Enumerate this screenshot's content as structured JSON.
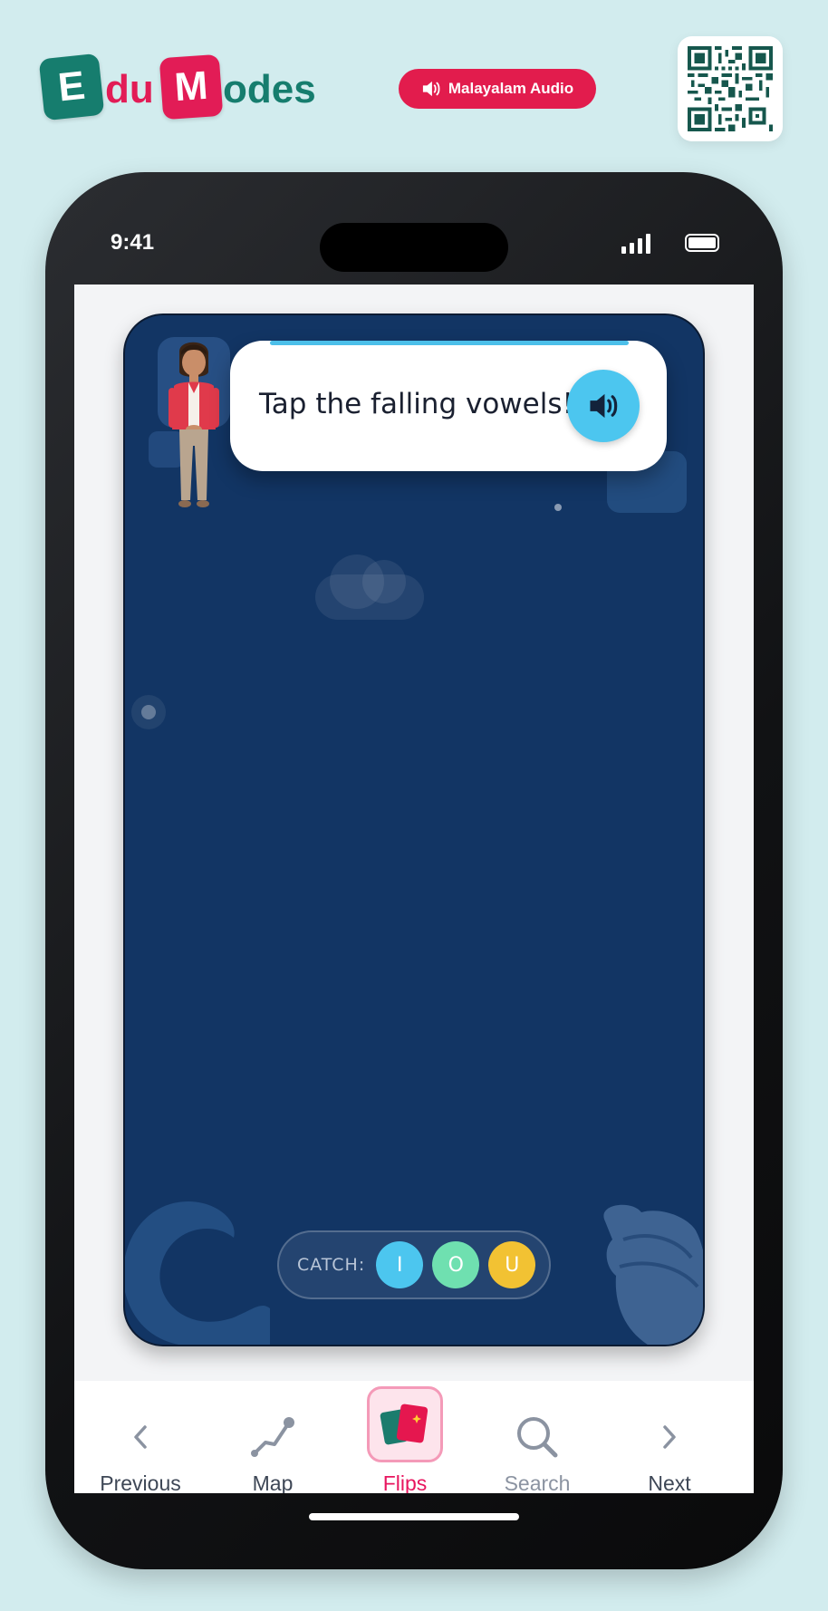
{
  "brand": {
    "tile_e": "E",
    "text_du": "du",
    "tile_m": "M",
    "text_odes": "odes"
  },
  "header": {
    "audio_label": "Malayalam Audio",
    "colors": {
      "teal": "#167d6e",
      "pink": "#e21c56",
      "background": "#d2ecee"
    }
  },
  "status_bar": {
    "time": "9:41"
  },
  "game": {
    "prompt": "Tap the falling vowels!",
    "catch_label": "CATCH:",
    "vowels": [
      {
        "letter": "I",
        "color": "#4cc6ef"
      },
      {
        "letter": "O",
        "color": "#6fe0b0"
      },
      {
        "letter": "U",
        "color": "#f2c233"
      }
    ],
    "background": "#123564"
  },
  "nav": {
    "items": [
      {
        "label": "Previous",
        "icon": "chevron-left-icon",
        "color": "#3e4756"
      },
      {
        "label": "Map",
        "icon": "map-route-icon",
        "color": "#3e4756"
      },
      {
        "label": "Flips",
        "icon": "flip-cards-icon",
        "color": "#e8165f",
        "active": true
      },
      {
        "label": "Search",
        "icon": "search-icon",
        "color": "#8b93a1"
      },
      {
        "label": "Next",
        "icon": "chevron-right-icon",
        "color": "#3e4756"
      }
    ]
  }
}
